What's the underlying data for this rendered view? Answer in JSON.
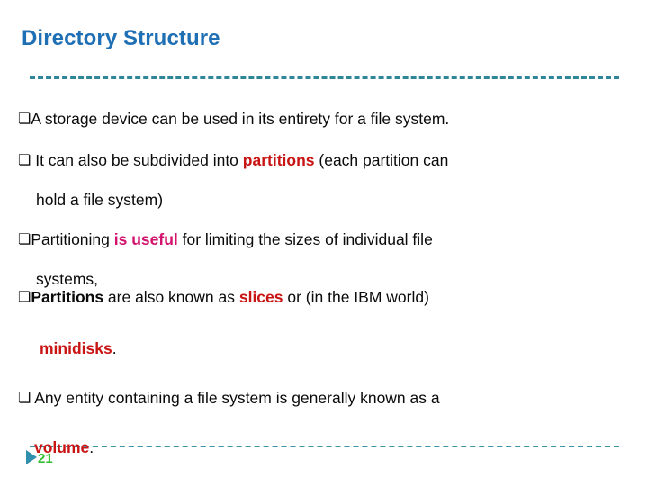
{
  "slide": {
    "title": "Directory Structure",
    "title_color": "#1f6fb5",
    "background_color": "#ffffff",
    "divider_color": "#2f8699"
  },
  "colors": {
    "red": "#c91414",
    "magenta": "#d2126d",
    "green": "#2fbe2f",
    "teal": "#2f8fad",
    "body_text": "#0a0a0a"
  },
  "icons": {
    "bullet": "❏",
    "triangle": "play-triangle-icon"
  },
  "bullets": [
    {
      "bullet": "❏",
      "segments": [
        {
          "text": "A storage device can be used in its entirety for a file system.",
          "style": "plain"
        }
      ]
    },
    {
      "bullet": "❏",
      "segments": [
        {
          "text": " It can also be subdivided into  ",
          "style": "plain"
        },
        {
          "text": "partitions",
          "style": "red-bold"
        },
        {
          "text": "  (each partition can",
          "style": "plain"
        }
      ],
      "continuation": "hold a file system)"
    },
    {
      "bullet": "❏",
      "segments": [
        {
          "text": "Partitioning ",
          "style": "plain"
        },
        {
          "text": "is useful ",
          "style": "magenta-bold-underline"
        },
        {
          "text": "for limiting the sizes of individual file",
          "style": "plain"
        }
      ],
      "continuation": "systems,"
    },
    {
      "bullet": "❏",
      "segments": [
        {
          "text": "Partitions",
          "style": "bold"
        },
        {
          "text": " are also known as ",
          "style": "plain"
        },
        {
          "text": "slices",
          "style": "red-bold"
        },
        {
          "text": " or (in the IBM world)",
          "style": "plain"
        }
      ],
      "continuation": "minidisks."
    },
    {
      "bullet": "❏",
      "segments": [
        {
          "text": " Any entity containing a file system is generally known as a",
          "style": "plain"
        }
      ],
      "continuation": "volume."
    }
  ],
  "lines": {
    "l1_bullet": "❏",
    "l1_text": "A storage device can be used in its entirety for a file system.",
    "l2_bullet": "❏",
    "l2_a": " It can also be subdivided into  ",
    "l2_b": "partitions",
    "l2_c": "  (each partition can",
    "l3_text": "hold a file system)",
    "l4_bullet": "❏",
    "l4_a": "Partitioning ",
    "l4_b": "is useful ",
    "l4_c": "for limiting the sizes of individual file",
    "l5_text": "systems,",
    "l6_bullet": "❏",
    "l6_a": "Partitions",
    "l6_b": " are also known as ",
    "l6_c": "slices",
    "l6_d": " or (in the IBM world)",
    "l7_a": "minidisks",
    "l7_b": ".",
    "l8_bullet": "❏",
    "l8_text": " Any entity containing a file system is generally known as a",
    "l9_a": "volume",
    "l9_b": "."
  },
  "footer": {
    "page_number": "21"
  }
}
